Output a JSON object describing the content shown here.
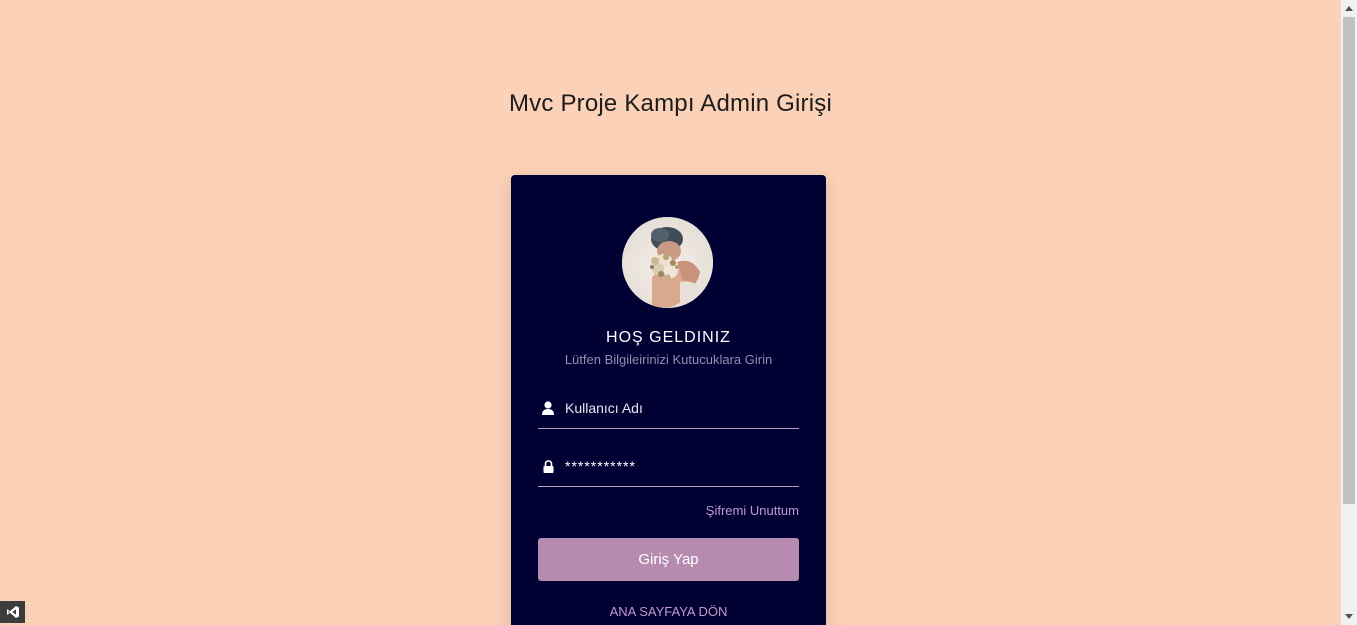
{
  "page": {
    "title": "Mvc Proje Kampı Admin Girişi",
    "background_color": "#fbd1b7"
  },
  "card": {
    "background_color": "#000033",
    "avatar_icon": "user-photo",
    "welcome": "HOŞ GELDINIZ",
    "subtitle": "Lütfen Bilgileirinizi Kutucuklara Girin",
    "username": {
      "icon": "user-icon",
      "placeholder": "Kullanıcı Adı",
      "value": ""
    },
    "password": {
      "icon": "lock-icon",
      "value": "***********"
    },
    "forgot_label": "Şifremi Unuttum",
    "login_label": "Giriş Yap",
    "login_color": "#b78bb0",
    "home_label": "ANA SAYFAYA DÖN"
  },
  "overlays": {
    "vs_badge_icon": "visual-studio-icon"
  }
}
